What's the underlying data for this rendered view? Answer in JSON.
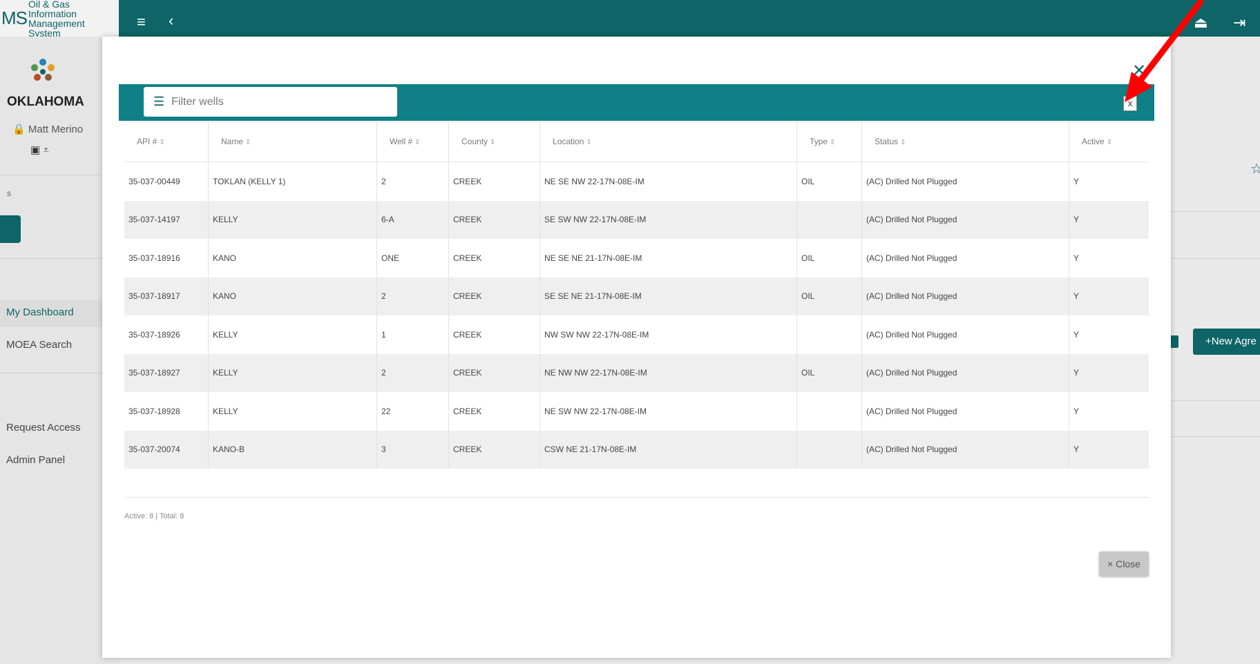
{
  "app": {
    "logo_ms": "MS",
    "logo_line1": "Oil & Gas Information",
    "logo_line2": "Management System"
  },
  "sidebar": {
    "state": "OKLAHOMA",
    "user": "Matt Merino",
    "section_label": "s",
    "items": [
      {
        "label": "My Dashboard"
      },
      {
        "label": "MOEA Search"
      },
      {
        "label": "Request Access"
      },
      {
        "label": "Admin Panel"
      }
    ]
  },
  "background": {
    "new_agreement_label": "+New Agre"
  },
  "modal": {
    "filter_placeholder": "Filter wells",
    "clear_label": "x",
    "close_label": "× Close",
    "footer": "Active: 8 | Total: 8",
    "columns": [
      "API #",
      "Name",
      "Well #",
      "County",
      "Location",
      "Type",
      "Status",
      "Active"
    ],
    "rows": [
      [
        "35-037-00449",
        "TOKLAN (KELLY 1)",
        "2",
        "CREEK",
        "NE SE NW 22-17N-08E-IM",
        "OIL",
        "(AC) Drilled Not Plugged",
        "Y"
      ],
      [
        "35-037-14197",
        "KELLY",
        "6-A",
        "CREEK",
        "SE SW NW 22-17N-08E-IM",
        "",
        "(AC) Drilled Not Plugged",
        "Y"
      ],
      [
        "35-037-18916",
        "KANO",
        "ONE",
        "CREEK",
        "NE SE NE 21-17N-08E-IM",
        "OIL",
        "(AC) Drilled Not Plugged",
        "Y"
      ],
      [
        "35-037-18917",
        "KANO",
        "2",
        "CREEK",
        "SE SE NE 21-17N-08E-IM",
        "OIL",
        "(AC) Drilled Not Plugged",
        "Y"
      ],
      [
        "35-037-18926",
        "KELLY",
        "1",
        "CREEK",
        "NW SW NW 22-17N-08E-IM",
        "",
        "(AC) Drilled Not Plugged",
        "Y"
      ],
      [
        "35-037-18927",
        "KELLY",
        "2",
        "CREEK",
        "NE NW NW 22-17N-08E-IM",
        "OIL",
        "(AC) Drilled Not Plugged",
        "Y"
      ],
      [
        "35-037-18928",
        "KELLY",
        "22",
        "CREEK",
        "NE SW NW 22-17N-08E-IM",
        "",
        "(AC) Drilled Not Plugged",
        "Y"
      ],
      [
        "35-037-20074",
        "KANO-B",
        "3",
        "CREEK",
        "CSW NE 21-17N-08E-IM",
        "",
        "(AC) Drilled Not Plugged",
        "Y"
      ]
    ]
  },
  "colors": {
    "brand_teal": "#0e6466",
    "filter_bar": "#0e8086",
    "annotation_arrow": "#ff0000"
  }
}
